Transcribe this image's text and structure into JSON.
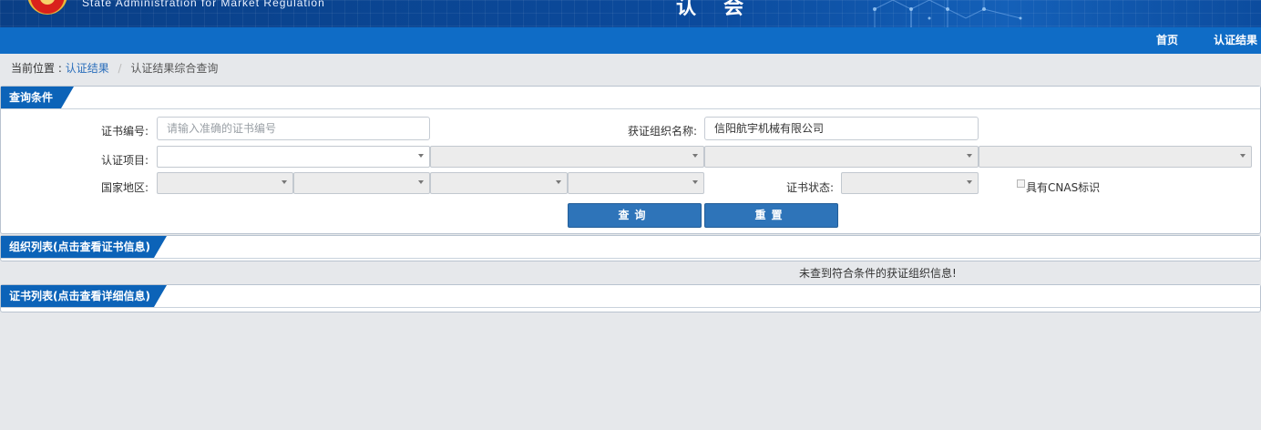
{
  "header": {
    "org_name_en": "State  Administration   for   Market  Regulation",
    "title_partial": "认 会"
  },
  "nav": {
    "items": [
      "首页",
      "认证结果"
    ]
  },
  "breadcrumb": {
    "prefix": "当前位置 :",
    "link": "认证结果",
    "separator": "/",
    "current": "认证结果综合查询"
  },
  "query_panel": {
    "title": "查询条件",
    "cert_number": {
      "label": "证书编号:",
      "placeholder": "请输入准确的证书编号",
      "value": ""
    },
    "org_name": {
      "label": "获证组织名称:",
      "value": "信阳航宇机械有限公司"
    },
    "cert_project": {
      "label": "认证项目:",
      "selects": [
        "",
        "",
        "",
        "",
        ""
      ]
    },
    "region": {
      "label": "国家地区:",
      "selects": [
        "",
        "",
        "",
        ""
      ]
    },
    "cert_status": {
      "label": "证书状态:",
      "value": ""
    },
    "cnas": {
      "label": "具有CNAS标识",
      "checked": false
    },
    "search_button": "查询",
    "reset_button": "重置"
  },
  "org_list_panel": {
    "title": "组织列表(点击查看证书信息)",
    "empty_message": "未查到符合条件的获证组织信息!"
  },
  "cert_list_panel": {
    "title": "证书列表(点击查看详细信息)"
  },
  "colors": {
    "banner": "#0b4a9c",
    "navbar": "#0f6cc6",
    "tab": "#0c63b8",
    "button": "#2e74b9",
    "page_bg": "#e6e8eb"
  }
}
